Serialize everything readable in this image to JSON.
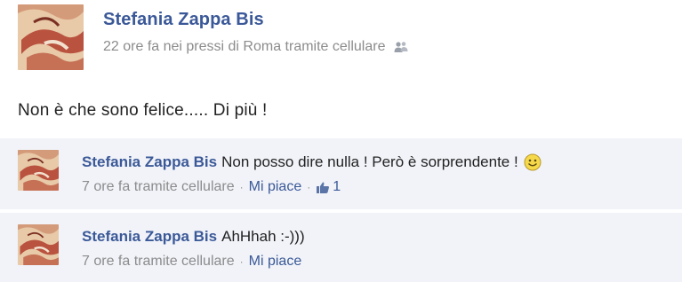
{
  "post": {
    "author": "Stefania Zappa Bis",
    "meta": "22 ore fa nei pressi di Roma tramite cellulare",
    "audience_icon": "people-icon",
    "text": "Non è che sono felice..... Di più !"
  },
  "comments": [
    {
      "author": "Stefania Zappa Bis",
      "text": "Non posso dire nulla ! Però è sorprendente !",
      "emoticon": "smiley-icon",
      "meta": "7 ore fa tramite cellulare",
      "separator": "·",
      "like_label": "Mi piace",
      "like_count": "1"
    },
    {
      "author": "Stefania Zappa Bis",
      "text": "AhHhah :-)))",
      "meta": "7 ore fa tramite cellulare",
      "separator": "·",
      "like_label": "Mi piace"
    }
  ],
  "colors": {
    "link": "#3b5998",
    "muted": "#8c8c8c",
    "comment_bg": "#f1f3f8"
  }
}
